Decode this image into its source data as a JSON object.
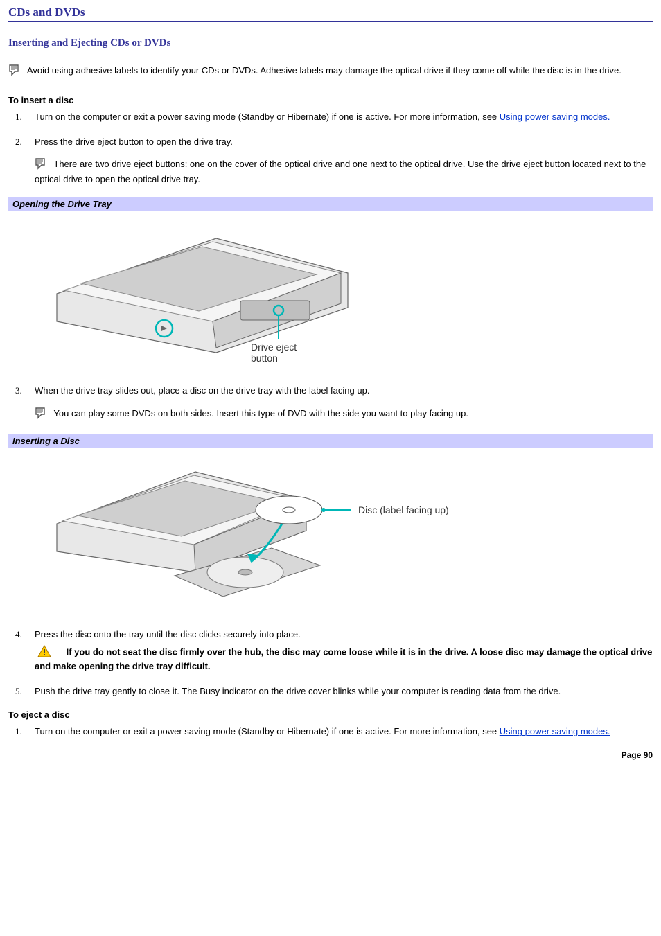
{
  "page": {
    "title": "CDs and DVDs",
    "section": "Inserting and Ejecting CDs or DVDs",
    "footer": "Page 90"
  },
  "intro_note": "Avoid using adhesive labels to identify your CDs or DVDs. Adhesive labels may damage the optical drive if they come off while the disc is in the drive.",
  "insert": {
    "heading": "To insert a disc",
    "step1_a": "Turn on the computer or exit a power saving mode (Standby or Hibernate) if one is active. For more information, see ",
    "step1_link": "Using power saving modes.",
    "step2": "Press the drive eject button to open the drive tray.",
    "step2_note": "There are two drive eject buttons: one on the cover of the optical drive and one next to the optical drive. Use the drive eject button located next to the optical drive to open the optical drive tray.",
    "fig1_title": "Opening the Drive Tray",
    "fig1_label": "Drive eject button",
    "step3": "When the drive tray slides out, place a disc on the drive tray with the label facing up.",
    "step3_note": "You can play some DVDs on both sides. Insert this type of DVD with the side you want to play facing up.",
    "fig2_title": "Inserting a Disc",
    "fig2_label": "Disc (label facing up)",
    "step4": "Press the disc onto the tray until the disc clicks securely into place.",
    "step4_caution": "If you do not seat the disc firmly over the hub, the disc may come loose while it is in the drive. A loose disc may damage the optical drive and make opening the drive tray difficult.",
    "step5": "Push the drive tray gently to close it. The Busy indicator on the drive cover blinks while your computer is reading data from the drive."
  },
  "eject": {
    "heading": "To eject a disc",
    "step1_a": "Turn on the computer or exit a power saving mode (Standby or Hibernate) if one is active. For more information, see ",
    "step1_link": "Using power saving modes."
  }
}
